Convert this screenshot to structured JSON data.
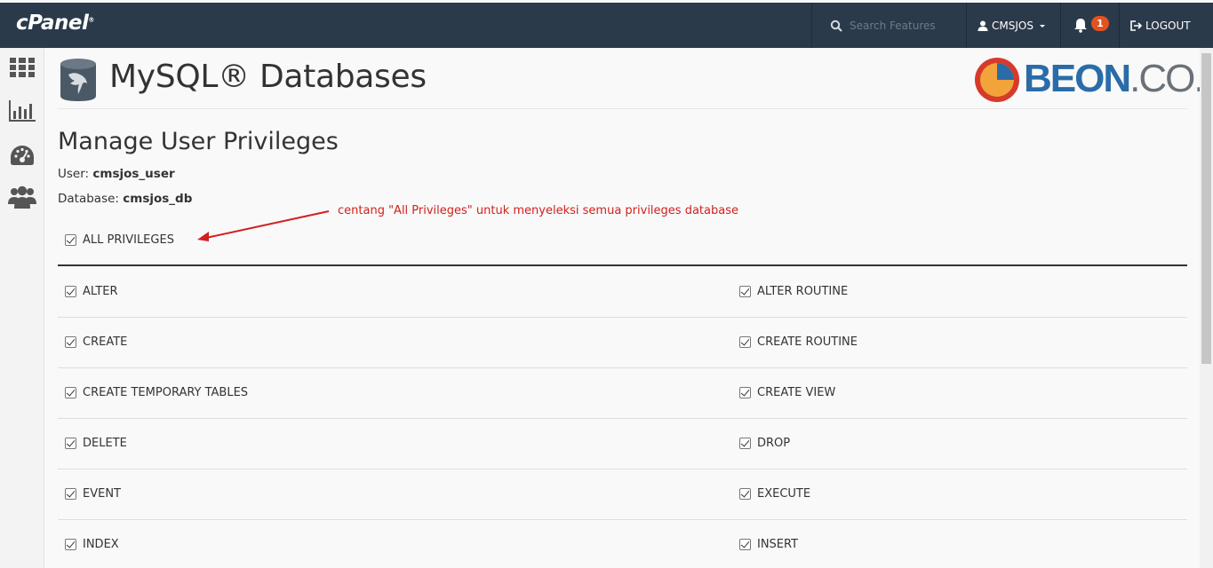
{
  "topbar": {
    "logo": "cPanel",
    "logo_mark": "®",
    "search_placeholder": "Search Features",
    "user": "CMSJOS",
    "notification_count": "1",
    "logout": "LOGOUT"
  },
  "sidebar": {
    "items": [
      "apps-grid-icon",
      "stats-chart-icon",
      "dashboard-gauge-icon",
      "users-icon"
    ]
  },
  "page": {
    "title": "MySQL® Databases",
    "brand_main": "BEON",
    "brand_suffix": ".CO.ID",
    "section_title": "Manage User Privileges",
    "user_label": "User:",
    "user_value": "cmsjos_user",
    "database_label": "Database:",
    "database_value": "cmsjos_db",
    "annotation": "centang \"All Privileges\" untuk menyeleksi semua privileges database",
    "all_privileges": "ALL PRIVILEGES"
  },
  "privileges": {
    "left": [
      "ALTER",
      "CREATE",
      "CREATE TEMPORARY TABLES",
      "DELETE",
      "EVENT",
      "INDEX"
    ],
    "right": [
      "ALTER ROUTINE",
      "CREATE ROUTINE",
      "CREATE VIEW",
      "DROP",
      "EXECUTE",
      "INSERT"
    ],
    "checked": true
  },
  "colors": {
    "topbar": "#2b3a4a",
    "badge": "#e0531f",
    "annotation": "#d02020",
    "brand_blue": "#2a6ca8"
  }
}
